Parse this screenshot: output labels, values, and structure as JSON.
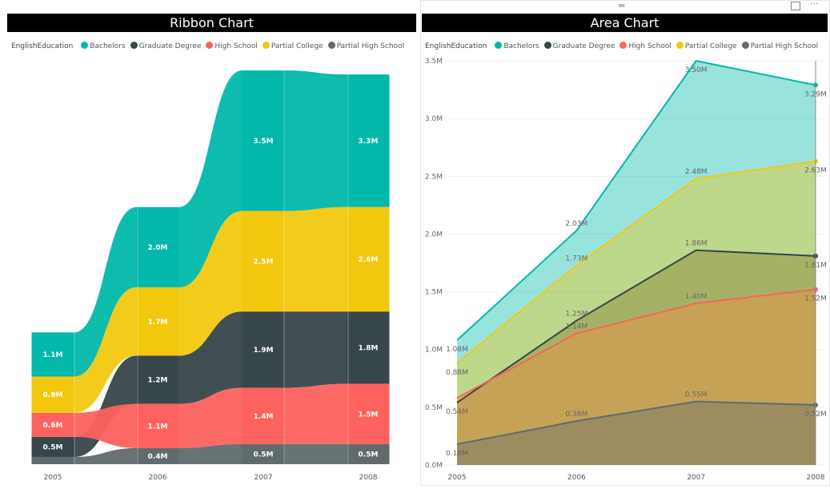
{
  "colors": {
    "Bachelors": "#01B8AA",
    "Graduate Degree": "#374649",
    "High School": "#FD625E",
    "Partial College": "#F2C80F",
    "Partial High School": "#5F6B6D"
  },
  "icons": {
    "drag": "drag-handle-icon",
    "focus": "focus-mode-icon",
    "more": "more-options-icon"
  },
  "chart_data": [
    {
      "type": "ribbon",
      "title": "Ribbon Chart",
      "legend_title": "EnglishEducation",
      "legend_position": "top-left",
      "categories": [
        "2005",
        "2006",
        "2007",
        "2008"
      ],
      "series": [
        {
          "name": "Bachelors",
          "values": [
            1.1,
            2.0,
            3.5,
            3.3
          ],
          "labels": [
            "1.1M",
            "2.0M",
            "3.5M",
            "3.3M"
          ]
        },
        {
          "name": "Graduate Degree",
          "values": [
            0.5,
            1.2,
            1.9,
            1.8
          ],
          "labels": [
            "0.5M",
            "1.2M",
            "1.9M",
            "1.8M"
          ]
        },
        {
          "name": "High School",
          "values": [
            0.6,
            1.1,
            1.4,
            1.5
          ],
          "labels": [
            "0.6M",
            "1.1M",
            "1.4M",
            "1.5M"
          ]
        },
        {
          "name": "Partial College",
          "values": [
            0.9,
            1.7,
            2.5,
            2.6
          ],
          "labels": [
            "0.9M",
            "1.7M",
            "2.5M",
            "2.6M"
          ]
        },
        {
          "name": "Partial High School",
          "values": [
            0.18,
            0.4,
            0.5,
            0.5
          ],
          "labels": [
            "",
            "0.4M",
            "0.5M",
            "0.5M"
          ]
        }
      ]
    },
    {
      "type": "area",
      "title": "Area Chart",
      "legend_title": "EnglishEducation",
      "legend_position": "top-left",
      "categories": [
        "2005",
        "2006",
        "2007",
        "2008"
      ],
      "ylim": [
        0,
        3.5
      ],
      "grid": true,
      "yticks": [
        "0.0M",
        "0.5M",
        "1.0M",
        "1.5M",
        "2.0M",
        "2.5M",
        "3.0M",
        "3.5M"
      ],
      "series": [
        {
          "name": "Bachelors",
          "values": [
            1.08,
            2.03,
            3.5,
            3.29
          ],
          "labels": [
            "1.08M",
            "2.03M",
            "3.50M",
            "3.29M"
          ]
        },
        {
          "name": "Graduate Degree",
          "values": [
            0.54,
            1.25,
            1.86,
            1.81
          ],
          "labels": [
            "0.54M",
            "1.25M",
            "1.86M",
            "1.81M"
          ]
        },
        {
          "name": "High School",
          "values": [
            0.58,
            1.14,
            1.4,
            1.52
          ],
          "labels": [
            "",
            "1.14M",
            "1.40M",
            "1.52M"
          ]
        },
        {
          "name": "Partial College",
          "values": [
            0.88,
            1.73,
            2.48,
            2.63
          ],
          "labels": [
            "0.88M",
            "1.73M",
            "2.48M",
            "2.63M"
          ]
        },
        {
          "name": "Partial High School",
          "values": [
            0.18,
            0.38,
            0.55,
            0.52
          ],
          "labels": [
            "0.18M",
            "0.38M",
            "0.55M",
            "0.52M"
          ]
        }
      ]
    }
  ]
}
